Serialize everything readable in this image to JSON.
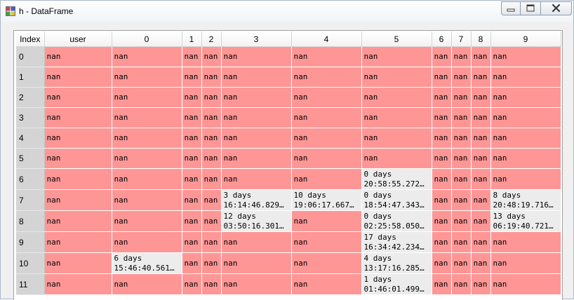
{
  "window": {
    "title": "h - DataFrame",
    "app_icon": "grid-icon",
    "controls": [
      "minimize-icon",
      "maximize-icon",
      "close-icon"
    ]
  },
  "table": {
    "columns": [
      "Index",
      "user",
      "0",
      "1",
      "2",
      "3",
      "4",
      "5",
      "6",
      "7",
      "8",
      "9"
    ],
    "rows": [
      {
        "index": "0",
        "cells": [
          "nan",
          "nan",
          "nan",
          "nan",
          "nan",
          "nan",
          "nan",
          "nan",
          "nan",
          "nan",
          "nan"
        ]
      },
      {
        "index": "1",
        "cells": [
          "nan",
          "nan",
          "nan",
          "nan",
          "nan",
          "nan",
          "nan",
          "nan",
          "nan",
          "nan",
          "nan"
        ]
      },
      {
        "index": "2",
        "cells": [
          "nan",
          "nan",
          "nan",
          "nan",
          "nan",
          "nan",
          "nan",
          "nan",
          "nan",
          "nan",
          "nan"
        ]
      },
      {
        "index": "3",
        "cells": [
          "nan",
          "nan",
          "nan",
          "nan",
          "nan",
          "nan",
          "nan",
          "nan",
          "nan",
          "nan",
          "nan"
        ]
      },
      {
        "index": "4",
        "cells": [
          "nan",
          "nan",
          "nan",
          "nan",
          "nan",
          "nan",
          "nan",
          "nan",
          "nan",
          "nan",
          "nan"
        ]
      },
      {
        "index": "5",
        "cells": [
          "nan",
          "nan",
          "nan",
          "nan",
          "nan",
          "nan",
          "nan",
          "nan",
          "nan",
          "nan",
          "nan"
        ]
      },
      {
        "index": "6",
        "cells": [
          "nan",
          "nan",
          "nan",
          "nan",
          "nan",
          "nan",
          "0 days\n20:58:55.272…",
          "nan",
          "nan",
          "nan",
          "nan"
        ]
      },
      {
        "index": "7",
        "cells": [
          "nan",
          "nan",
          "nan",
          "nan",
          "3 days\n16:14:46.829…",
          "10 days\n19:06:17.667…",
          "0 days\n18:54:47.343…",
          "nan",
          "nan",
          "nan",
          "8 days\n20:48:19.716…"
        ]
      },
      {
        "index": "8",
        "cells": [
          "nan",
          "nan",
          "nan",
          "nan",
          "12 days\n03:50:16.301…",
          "nan",
          "0 days\n02:25:58.050…",
          "nan",
          "nan",
          "nan",
          "13 days\n06:19:40.721…"
        ]
      },
      {
        "index": "9",
        "cells": [
          "nan",
          "nan",
          "nan",
          "nan",
          "nan",
          "nan",
          "17 days\n16:34:42.234…",
          "nan",
          "nan",
          "nan",
          "nan"
        ]
      },
      {
        "index": "10",
        "cells": [
          "nan",
          "6 days\n15:46:40.561…",
          "nan",
          "nan",
          "nan",
          "nan",
          "4 days\n13:17:16.285…",
          "nan",
          "nan",
          "nan",
          "nan"
        ]
      },
      {
        "index": "11",
        "cells": [
          "nan",
          "nan",
          "nan",
          "nan",
          "nan",
          "nan",
          "1 days\n01:46:01.499…",
          "nan",
          "nan",
          "nan",
          "nan"
        ]
      }
    ]
  },
  "colors": {
    "missing_cell": "#ff9696",
    "value_cell": "#ececec",
    "index_cell": "#d4d4d4"
  }
}
